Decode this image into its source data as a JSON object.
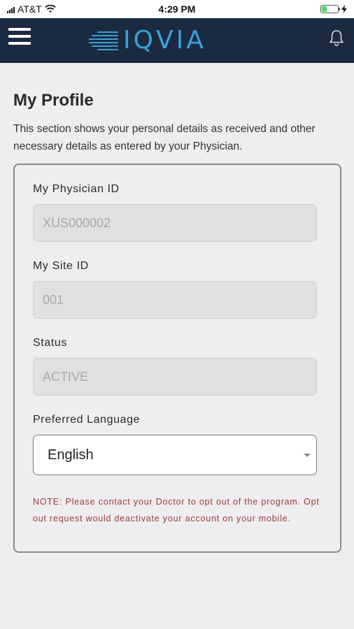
{
  "status_bar": {
    "carrier": "AT&T",
    "time": "4:29 PM",
    "battery_level": 0.3,
    "battery_color": "#4cd964"
  },
  "header": {
    "logo_text": "IQVIA",
    "menu_icon": "hamburger-menu-icon",
    "notification_icon": "bell-icon",
    "background_color": "#1b2a40",
    "brand_color": "#3aa0d8"
  },
  "profile": {
    "title": "My Profile",
    "description": "This section shows your personal details as received and other necessary details as entered by your Physician.",
    "fields": [
      {
        "label": "My Physician ID",
        "value": "XUS000002"
      },
      {
        "label": "My Site ID",
        "value": "001"
      },
      {
        "label": "Status",
        "value": "ACTIVE"
      }
    ],
    "language": {
      "label": "Preferred Language",
      "selected": "English"
    },
    "note": "NOTE: Please contact your Doctor to opt out of the program. Opt out request would deactivate your account on your mobile.",
    "note_color": "#a1383d"
  }
}
